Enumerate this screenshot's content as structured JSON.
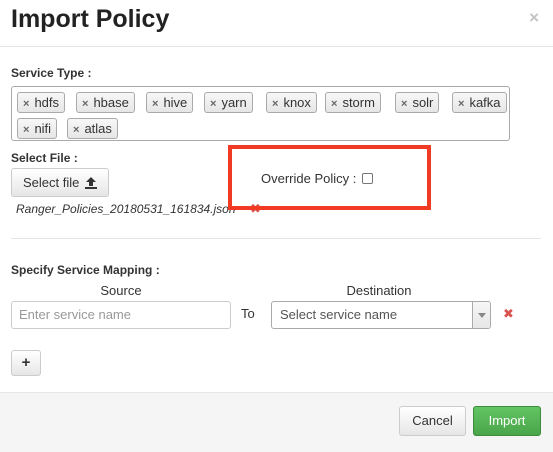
{
  "dialog": {
    "title": "Import Policy",
    "close_glyph": "×"
  },
  "service_type": {
    "label": "Service Type :",
    "tags": [
      "hdfs",
      "hbase",
      "hive",
      "yarn",
      "knox",
      "storm",
      "solr",
      "kafka",
      "nifi",
      "atlas"
    ],
    "remove_glyph": "×"
  },
  "select_file": {
    "label": "Select File :",
    "button_label": "Select file",
    "button_icon": "upload-icon",
    "file_name": "Ranger_Policies_20180531_161834.json",
    "remove_glyph": "✖"
  },
  "override": {
    "label": "Override Policy :",
    "checked": false,
    "highlight_color": "#f03a24"
  },
  "mapping": {
    "label": "Specify Service Mapping :",
    "source_header": "Source",
    "destination_header": "Destination",
    "source_placeholder": "Enter service name",
    "to_label": "To",
    "destination_placeholder": "Select service name",
    "remove_glyph": "✖",
    "add_label": "+"
  },
  "footer": {
    "cancel_label": "Cancel",
    "import_label": "Import",
    "import_color": "#5cb85c"
  }
}
